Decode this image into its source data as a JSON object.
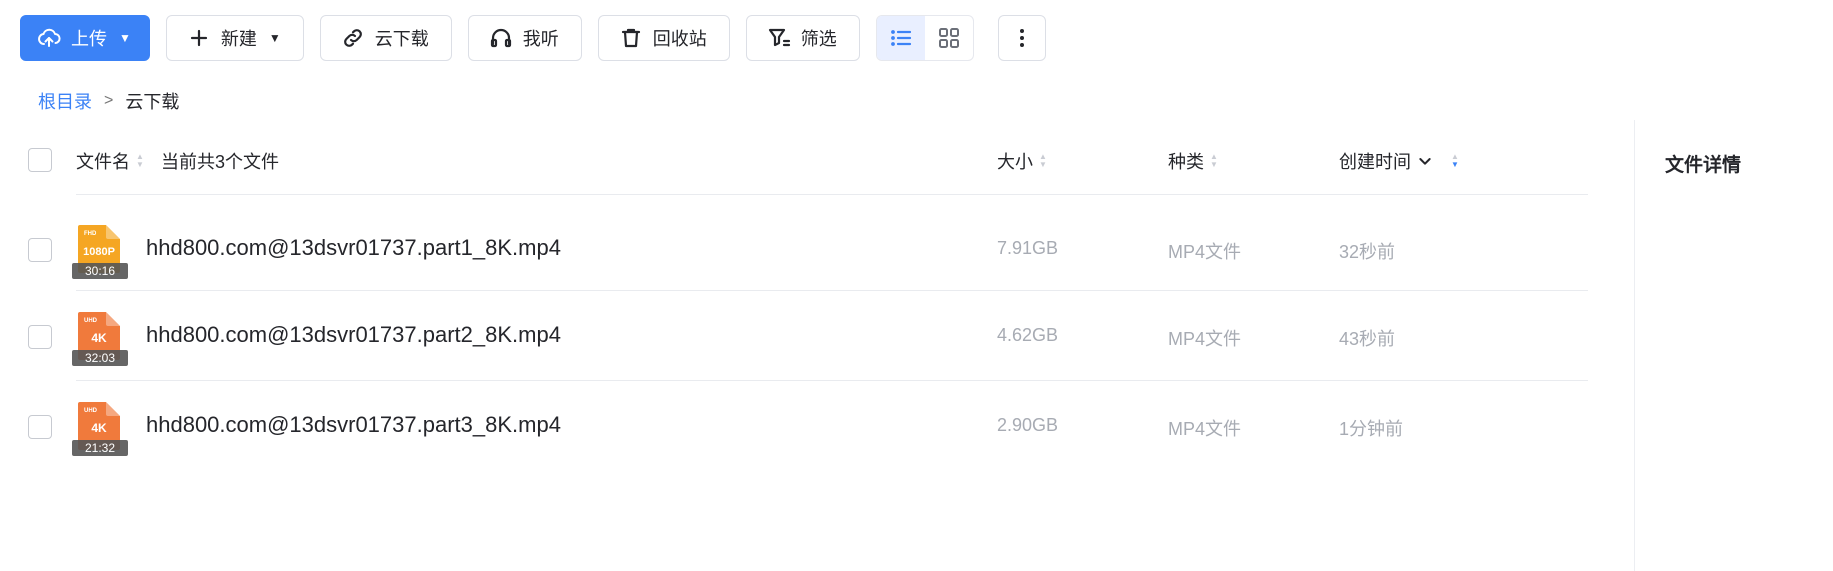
{
  "toolbar": {
    "upload": "上传",
    "new": "新建",
    "cloud_download": "云下载",
    "listen": "我听",
    "recycle": "回收站",
    "filter": "筛选"
  },
  "breadcrumb": {
    "root": "根目录",
    "current": "云下载"
  },
  "header": {
    "name": "文件名",
    "count_text": "当前共3个文件",
    "size": "大小",
    "type": "种类",
    "created": "创建时间"
  },
  "files": [
    {
      "name": "hhd800.com@13dsvr01737.part1_8K.mp4",
      "badge": "1080P",
      "corner": "FHD",
      "duration": "30:16",
      "size": "7.91GB",
      "type": "MP4文件",
      "time": "32秒前",
      "color": "#f5a623"
    },
    {
      "name": "hhd800.com@13dsvr01737.part2_8K.mp4",
      "badge": "4K",
      "corner": "UHD",
      "duration": "32:03",
      "size": "4.62GB",
      "type": "MP4文件",
      "time": "43秒前",
      "color": "#f07a3c"
    },
    {
      "name": "hhd800.com@13dsvr01737.part3_8K.mp4",
      "badge": "4K",
      "corner": "UHD",
      "duration": "21:32",
      "size": "2.90GB",
      "type": "MP4文件",
      "time": "1分钟前",
      "color": "#f07a3c"
    }
  ],
  "detail": {
    "title": "文件详情"
  },
  "colors": {
    "accent": "#3b82f6"
  }
}
